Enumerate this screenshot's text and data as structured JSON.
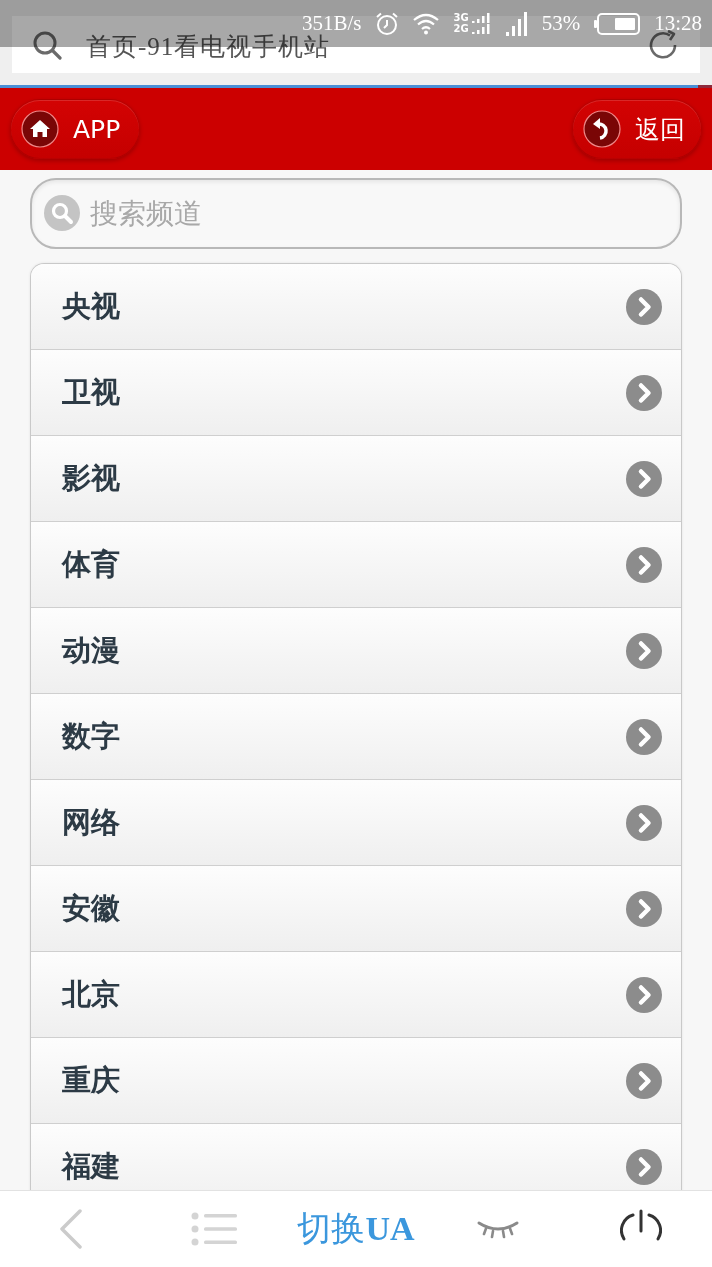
{
  "status_bar": {
    "network_speed": "351B/s",
    "network_types": [
      "3G",
      "2G"
    ],
    "battery": "53%",
    "time": "13:28"
  },
  "address_bar": {
    "value": "首页-91看电视手机站"
  },
  "page_progress": {
    "level": 0.98
  },
  "header": {
    "buttons": [
      {
        "kind": "home",
        "label": "APP"
      },
      {
        "kind": "back",
        "label": "返回"
      }
    ]
  },
  "search": {
    "placeholder": "搜索频道"
  },
  "channels": [
    {
      "name": "央视"
    },
    {
      "name": "卫视"
    },
    {
      "name": "影视"
    },
    {
      "name": "体育"
    },
    {
      "name": "动漫"
    },
    {
      "name": "数字"
    },
    {
      "name": "网络"
    },
    {
      "name": "安徽"
    },
    {
      "name": "北京"
    },
    {
      "name": "重庆"
    },
    {
      "name": "福建"
    }
  ],
  "toolbar": {
    "items": [
      {
        "kind": "back"
      },
      {
        "kind": "menu"
      },
      {
        "kind": "text",
        "label": "切换**UA**"
      },
      {
        "kind": "eye"
      },
      {
        "kind": "power"
      }
    ]
  }
}
